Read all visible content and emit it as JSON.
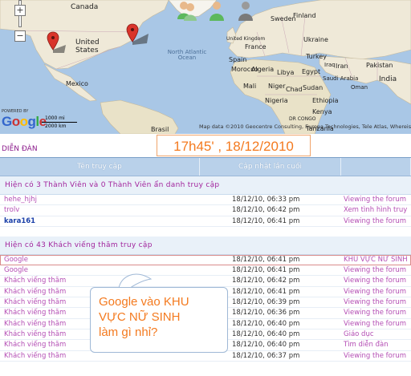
{
  "map": {
    "labels": {
      "canada": "Canada",
      "united_states": "United\nStates",
      "mexico": "Mexico",
      "north_atlantic_ocean": "North Atlantic Ocean",
      "brasil": "Brasil",
      "sweden": "Sweden",
      "finland": "Finland",
      "united_kingdom": "United Kingdom",
      "ukraine": "Ukraine",
      "spain": "Spain",
      "france": "France",
      "turkey": "Turkey",
      "iran": "Iran",
      "pakistan": "Pakistan",
      "india": "India",
      "morocco": "Morocco",
      "algeria": "Algeria",
      "libya": "Libya",
      "egypt": "Egypt",
      "mali": "Mali",
      "niger": "Niger",
      "chad": "Chad",
      "sudan": "Sudan",
      "nigeria": "Nigeria",
      "ethiopia": "Ethiopia",
      "kenya": "Kenya",
      "dr_congo": "DR CONGO",
      "tanzania": "Tanzania",
      "saudi_arabia": "Saudi Arabia",
      "iraq": "Iraq",
      "oman": "Oman"
    },
    "zoom_in": "+",
    "zoom_out": "−",
    "powered_by": "POWERED BY",
    "logo": [
      "G",
      "o",
      "o",
      "g",
      "l",
      "e"
    ],
    "logo_colors": [
      "#3366cc",
      "#cc3333",
      "#ffbb00",
      "#3366cc",
      "#33aa44",
      "#cc3333"
    ],
    "scale_miles": "1000 mi",
    "scale_km": "2000 km",
    "attribution": "Map data ©2010 Geocentre Consulting, Europa Technologies, Tele Atlas, Whereis(R), Sensis",
    "pin_color": "#d9342b"
  },
  "timestamp": "17h45' , 18/12/2010",
  "forum_link": "DIỄN ĐÀN",
  "table": {
    "headers": [
      "Tên truy cập",
      "Cập nhật lần cuối",
      ""
    ],
    "members_section": "Hiện có 3 Thành Viên và 0 Thành Viên ẩn danh truy cập",
    "members": [
      {
        "name": "hehe_hjhj",
        "time": "18/12/10, 06:33 pm",
        "page": "Viewing the forum",
        "color": "#b44eb4"
      },
      {
        "name": "trolv",
        "time": "18/12/10, 06:42 pm",
        "page": "Xem tình hình truy",
        "color": "#b44eb4"
      },
      {
        "name": "kara161",
        "time": "18/12/10, 06:41 pm",
        "page": "Viewing the forum",
        "color": "#1a3fa8"
      }
    ],
    "guests_section": "Hiện có 43 Khách viếng thăm truy cập",
    "guests": [
      {
        "name": "Google",
        "time": "18/12/10, 06:41 pm",
        "page": "KHU VỰC NỮ SINH",
        "highlight": true
      },
      {
        "name": "Google",
        "time": "18/12/10, 06:41 pm",
        "page": "Viewing the forum"
      },
      {
        "name": "Khách viếng thăm",
        "time": "18/12/10, 06:42 pm",
        "page": "Viewing the forum"
      },
      {
        "name": "Khách viếng thăm",
        "time": "18/12/10, 06:41 pm",
        "page": "Viewing the forum"
      },
      {
        "name": "Khách viếng thăm",
        "time": "18/12/10, 06:39 pm",
        "page": "Viewing the forum"
      },
      {
        "name": "Khách viếng thăm",
        "time": "18/12/10, 06:36 pm",
        "page": "Viewing the forum"
      },
      {
        "name": "Khách viếng thăm",
        "time": "18/12/10, 06:40 pm",
        "page": "Viewing the forum"
      },
      {
        "name": "Khách viếng thăm",
        "time": "18/12/10, 06:40 pm",
        "page": "Giáo dục"
      },
      {
        "name": "Khách viếng thăm",
        "time": "18/12/10, 06:40 pm",
        "page": "Tìm diễn đàn"
      },
      {
        "name": "Khách viếng thăm",
        "time": "18/12/10, 06:37 pm",
        "page": "Viewing the forum"
      }
    ]
  },
  "callout": {
    "line1": "Google vào KHU",
    "line2": "VỰC NỮ SINH",
    "line3": "làm gì nhỉ?"
  }
}
